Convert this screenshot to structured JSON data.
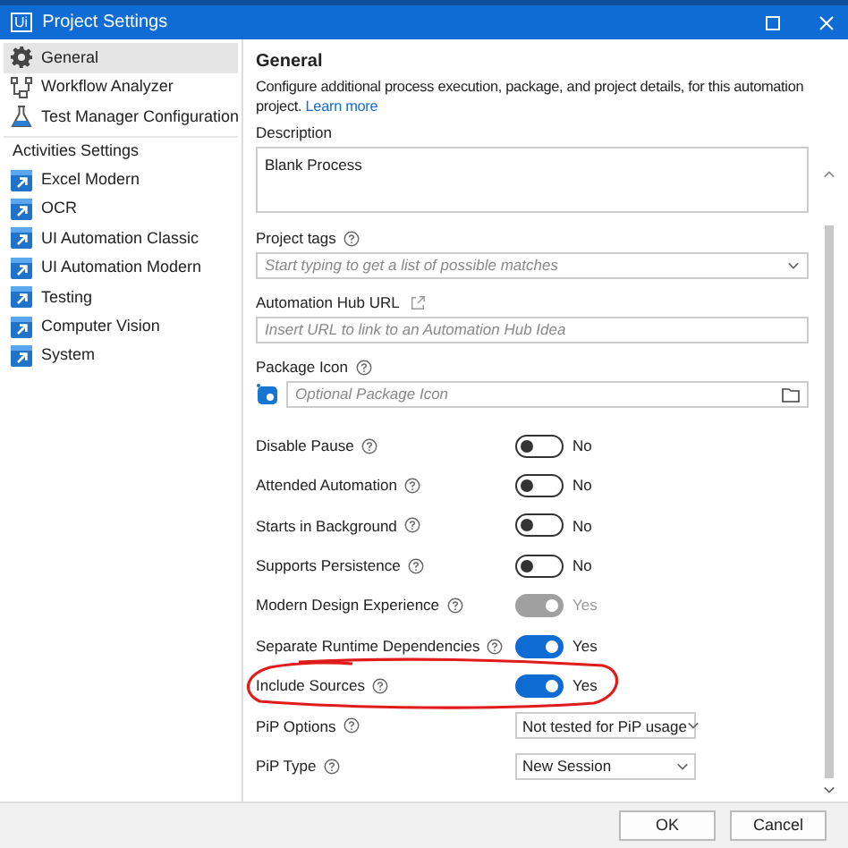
{
  "window": {
    "logo": "Ui",
    "title": "Project Settings"
  },
  "sidebar": {
    "items": [
      {
        "label": "General",
        "kind": "gear",
        "selected": true
      },
      {
        "label": "Workflow Analyzer",
        "kind": "workflow",
        "selected": false
      },
      {
        "label": "Test Manager Configuration",
        "kind": "flask",
        "selected": false
      }
    ],
    "section": "Activities Settings",
    "activities": [
      {
        "label": "Excel Modern",
        "selected": false
      },
      {
        "label": "OCR",
        "selected": false
      },
      {
        "label": "UI Automation Classic",
        "selected": false
      },
      {
        "label": "UI Automation Modern",
        "selected": false
      },
      {
        "label": "Testing",
        "selected": false
      },
      {
        "label": "Computer Vision",
        "selected": false
      },
      {
        "label": "System",
        "selected": false
      }
    ]
  },
  "content": {
    "heading": "General",
    "intro": "Configure additional process execution, package, and project details, for this automation project.",
    "learn_more": "Learn more",
    "fields": [
      {
        "kind": "textarea",
        "label": "Description",
        "value": "Blank Process"
      },
      {
        "kind": "combo",
        "label": "Project tags",
        "help": true,
        "placeholder": "Start typing to get a list of possible matches"
      },
      {
        "kind": "url",
        "label": "Automation Hub URL",
        "placeholder": "Insert URL to link to an Automation Hub Idea"
      },
      {
        "kind": "file",
        "label": "Package Icon",
        "help": true,
        "placeholder": "Optional Package Icon"
      }
    ],
    "settings": [
      {
        "kind": "toggle",
        "label": "Disable Pause",
        "on": false,
        "disabled": false,
        "value": "No"
      },
      {
        "kind": "toggle",
        "label": "Attended Automation",
        "on": false,
        "disabled": false,
        "value": "No"
      },
      {
        "kind": "toggle",
        "label": "Starts in Background",
        "on": false,
        "disabled": false,
        "value": "No"
      },
      {
        "kind": "toggle",
        "label": "Supports Persistence",
        "on": false,
        "disabled": false,
        "value": "No"
      },
      {
        "kind": "toggle",
        "label": "Modern Design Experience",
        "on": true,
        "disabled": true,
        "value": "Yes"
      },
      {
        "kind": "toggle",
        "label": "Separate Runtime Dependencies",
        "on": true,
        "disabled": false,
        "value": "Yes"
      },
      {
        "kind": "toggle",
        "label": "Include Sources",
        "on": true,
        "disabled": false,
        "value": "Yes",
        "highlighted": true
      },
      {
        "kind": "select",
        "label": "PiP Options",
        "value": "Not tested for PiP usage"
      },
      {
        "kind": "select",
        "label": "PiP Type",
        "value": "New Session"
      }
    ]
  },
  "buttons": [
    "OK",
    "Cancel"
  ]
}
